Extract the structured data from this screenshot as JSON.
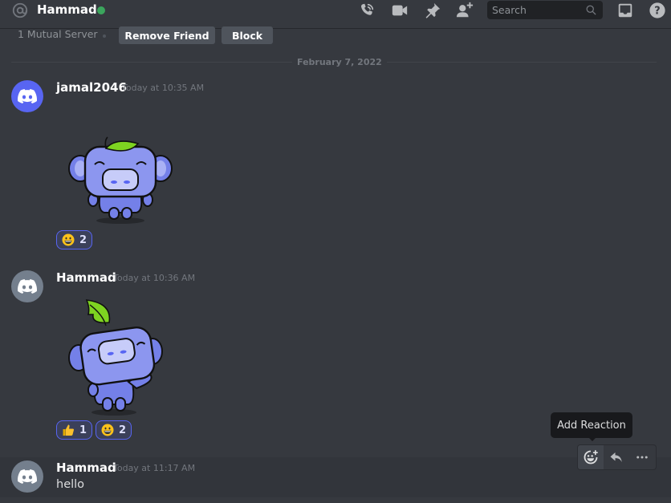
{
  "header": {
    "title": "Hammad",
    "status": "online",
    "status_color": "#3ba55d",
    "icons": [
      "at-icon",
      "start-voice-call-icon",
      "start-video-call-icon",
      "pinned-messages-icon",
      "add-friends-to-dm-icon",
      "inbox-icon",
      "help-icon"
    ],
    "search": {
      "placeholder": "Search",
      "value": ""
    }
  },
  "profile_bar": {
    "mutual_servers": "1 Mutual Server",
    "remove_friend_label": "Remove Friend",
    "block_label": "Block"
  },
  "date_divider": "February 7, 2022",
  "messages": [
    {
      "author": "jamal2046",
      "timestamp": "Today at 10:35 AM",
      "avatar_color": "#5865f2",
      "content_type": "sticker",
      "sticker": "wumpus-leaf-smiling",
      "reactions": [
        {
          "emoji": "grinning-face",
          "count": "2"
        }
      ]
    },
    {
      "author": "Hammad",
      "timestamp": "Today at 10:36 AM",
      "avatar_color": "#747f8d",
      "content_type": "sticker",
      "sticker": "wumpus-leaf-waving",
      "reactions": [
        {
          "emoji": "thumbs-up",
          "count": "1"
        },
        {
          "emoji": "grinning-face",
          "count": "2"
        }
      ]
    },
    {
      "author": "Hammad",
      "timestamp": "Today at 11:17 AM",
      "avatar_color": "#747f8d",
      "content_type": "text",
      "text": "hello"
    }
  ],
  "message_actions": {
    "tooltip": "Add Reaction",
    "buttons": [
      "add-reaction",
      "reply",
      "more"
    ]
  }
}
